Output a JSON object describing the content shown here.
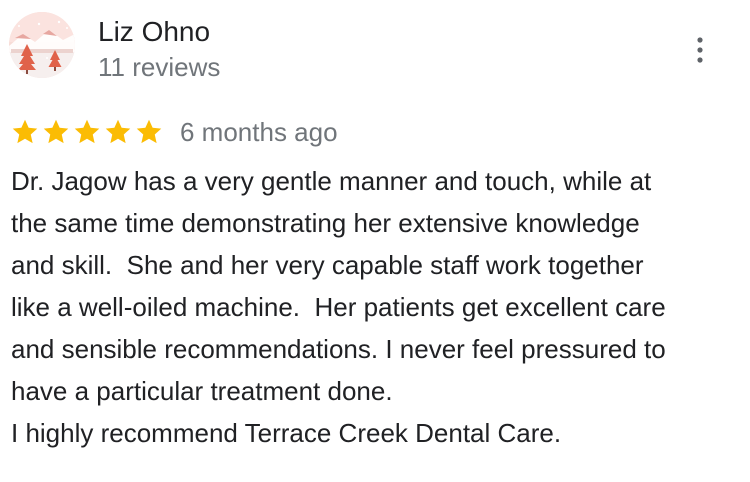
{
  "reviewer": {
    "name": "Liz Ohno",
    "reviews_count": "11 reviews",
    "avatar_icon": "winter-landscape-avatar"
  },
  "menu": {
    "icon": "more-vert-icon"
  },
  "rating": {
    "stars": 5,
    "max_stars": 5,
    "star_color": "#fbbc04",
    "date": "6 months ago"
  },
  "review": {
    "lines": [
      "Dr. Jagow has a very gentle manner and touch, while at",
      "the same time demonstrating her extensive knowledge",
      "and skill.  She and her very capable staff work together",
      "like a well-oiled machine.  Her patients get excellent care",
      "and sensible recommendations. I never feel pressured to",
      "have a particular treatment done.",
      "I highly recommend Terrace Creek Dental Care."
    ]
  },
  "colors": {
    "primary_text": "#202124",
    "secondary_text": "#70757a",
    "background": "#ffffff"
  }
}
